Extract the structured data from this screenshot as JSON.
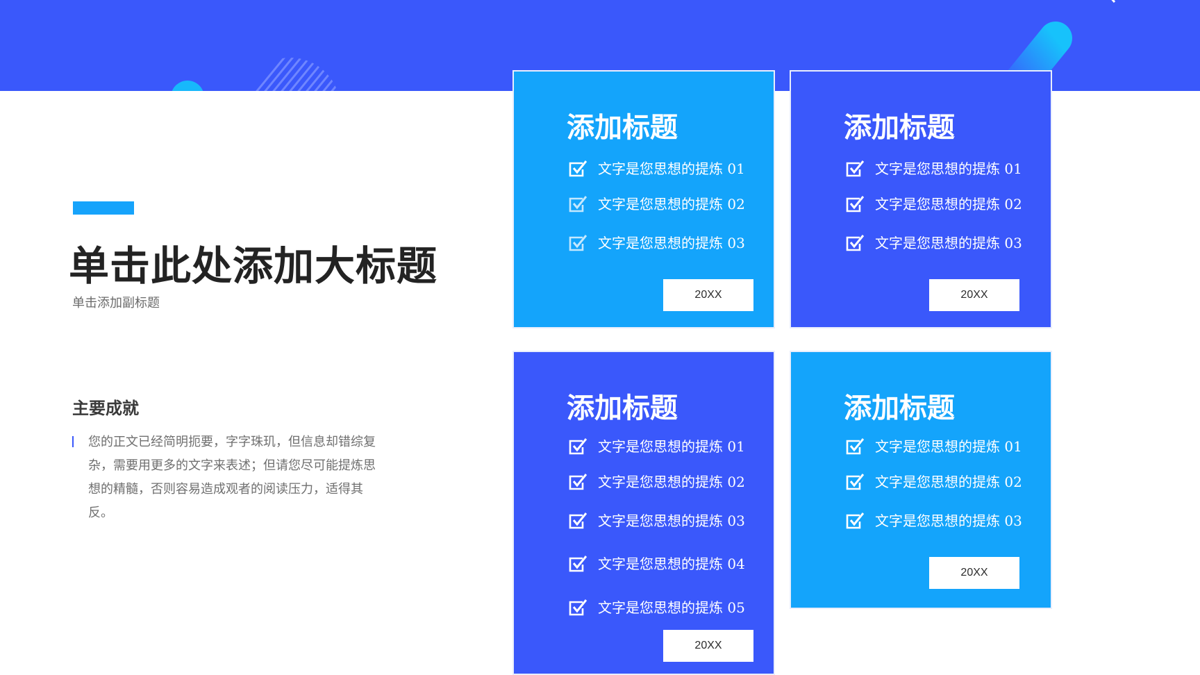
{
  "colors": {
    "band": "#3a58fb",
    "light_card": "#14a4fb",
    "dark_card": "#3a58fb",
    "accent": "#16a3fb"
  },
  "header": {
    "main_title": "单击此处添加大标题",
    "subtitle": "单击添加副标题"
  },
  "section": {
    "title": "主要成就",
    "body": "您的正文已经简明扼要，字字珠玑，但信息却错综复杂，需要用更多的文字来表述；但请您尽可能提炼思想的精髓，否则容易造成观者的阅读压力，适得其反。"
  },
  "cards": [
    {
      "title": "添加标题",
      "items": [
        "文字是您思想的提炼 01",
        "文字是您思想的提炼 02",
        "文字是您思想的提炼 03"
      ],
      "button": "20XX"
    },
    {
      "title": "添加标题",
      "items": [
        "文字是您思想的提炼 01",
        "文字是您思想的提炼 02",
        "文字是您思想的提炼 03"
      ],
      "button": "20XX"
    },
    {
      "title": "添加标题",
      "items": [
        "文字是您思想的提炼 01",
        "文字是您思想的提炼 02",
        "文字是您思想的提炼 03",
        "文字是您思想的提炼 04",
        "文字是您思想的提炼 05"
      ],
      "button": "20XX"
    },
    {
      "title": "添加标题",
      "items": [
        "文字是您思想的提炼 01",
        "文字是您思想的提炼 02",
        "文字是您思想的提炼 03"
      ],
      "button": "20XX"
    }
  ]
}
